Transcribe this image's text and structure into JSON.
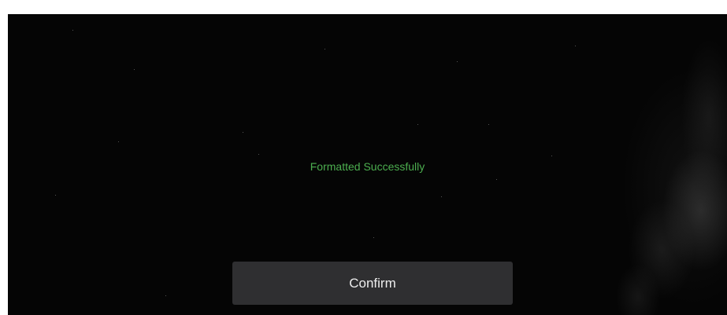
{
  "dialog": {
    "message": "Formatted Successfully",
    "confirm_label": "Confirm"
  },
  "colors": {
    "message": "#4cae4f",
    "button_background": "#2f2f31",
    "background": "#050505"
  }
}
